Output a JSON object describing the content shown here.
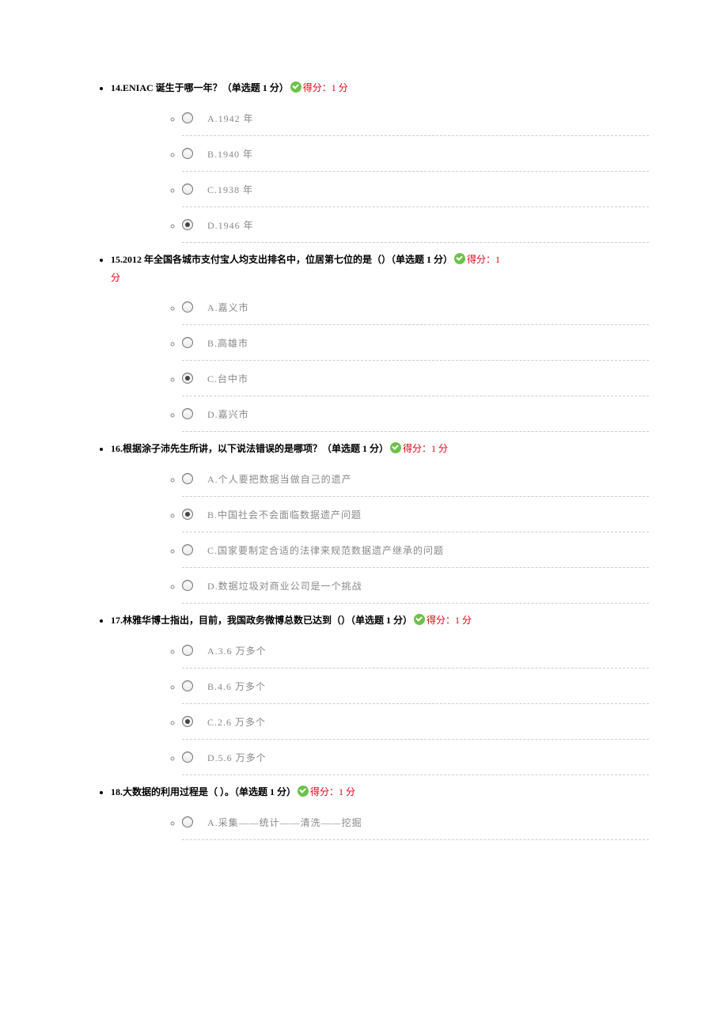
{
  "score_label": "得分：1 分",
  "type_label": "（单选题 1 分）",
  "questions": [
    {
      "num": "14.",
      "text": "ENIAC 诞生于哪一年？",
      "options": [
        {
          "label": "A.1942 年",
          "selected": false
        },
        {
          "label": "B.1940 年",
          "selected": false
        },
        {
          "label": "C.1938 年",
          "selected": false
        },
        {
          "label": "D.1946 年",
          "selected": true
        }
      ]
    },
    {
      "num": "15.",
      "text": "2012 年全国各城市支付宝人均支出排名中，位居第七位的是（）",
      "score_wrap": true,
      "options": [
        {
          "label": "A.嘉义市",
          "selected": false
        },
        {
          "label": "B.高雄市",
          "selected": false
        },
        {
          "label": "C.台中市",
          "selected": true
        },
        {
          "label": "D.嘉兴市",
          "selected": false
        }
      ]
    },
    {
      "num": "16.",
      "text": "根据涂子沛先生所讲，以下说法错误的是哪项？",
      "options": [
        {
          "label": "A.个人要把数据当做自己的遗产",
          "selected": false
        },
        {
          "label": "B.中国社会不会面临数据遗产问题",
          "selected": true
        },
        {
          "label": "C.国家要制定合适的法律来规范数据遗产继承的问题",
          "selected": false
        },
        {
          "label": "D.数据垃圾对商业公司是一个挑战",
          "selected": false
        }
      ]
    },
    {
      "num": "17.",
      "text": "林雅华博士指出，目前，我国政务微博总数已达到（）",
      "options": [
        {
          "label": "A.3.6 万多个",
          "selected": false
        },
        {
          "label": "B.4.6 万多个",
          "selected": false
        },
        {
          "label": "C.2.6 万多个",
          "selected": true
        },
        {
          "label": "D.5.6 万多个",
          "selected": false
        }
      ]
    },
    {
      "num": "18.",
      "text": "大数据的利用过程是（ ）。",
      "options": [
        {
          "label": "A.采集——统计——清洗——挖掘",
          "selected": false
        }
      ]
    }
  ]
}
